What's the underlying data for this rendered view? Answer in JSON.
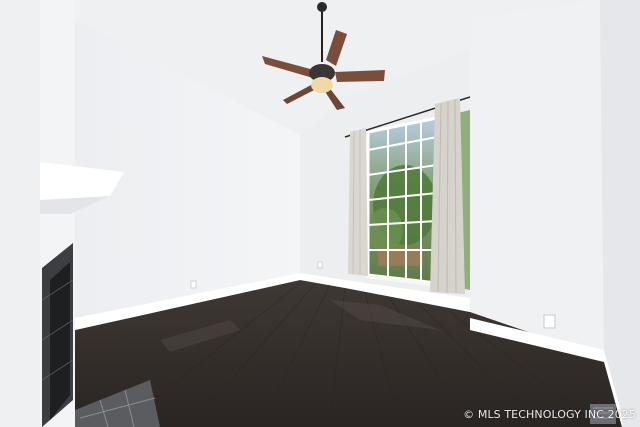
{
  "photo": {
    "watermark": "© MLS TECHNOLOGY INC 2025",
    "colors": {
      "wall_light": "#f1f2f4",
      "wall_shade": "#e2e4e7",
      "ceiling": "#f3f4f6",
      "floor": "#3a3430",
      "floor_dark": "#2c2724",
      "curtain": "#d9d6d0",
      "fan_blade": "#7a4e3a",
      "fireplace": "#2b2b2d"
    },
    "objects": [
      "ceiling-fan",
      "window",
      "curtains",
      "fireplace",
      "mantel",
      "hardwood-floor",
      "baseboard",
      "hearth-tiles",
      "floor-vent",
      "wall-outlet"
    ]
  }
}
